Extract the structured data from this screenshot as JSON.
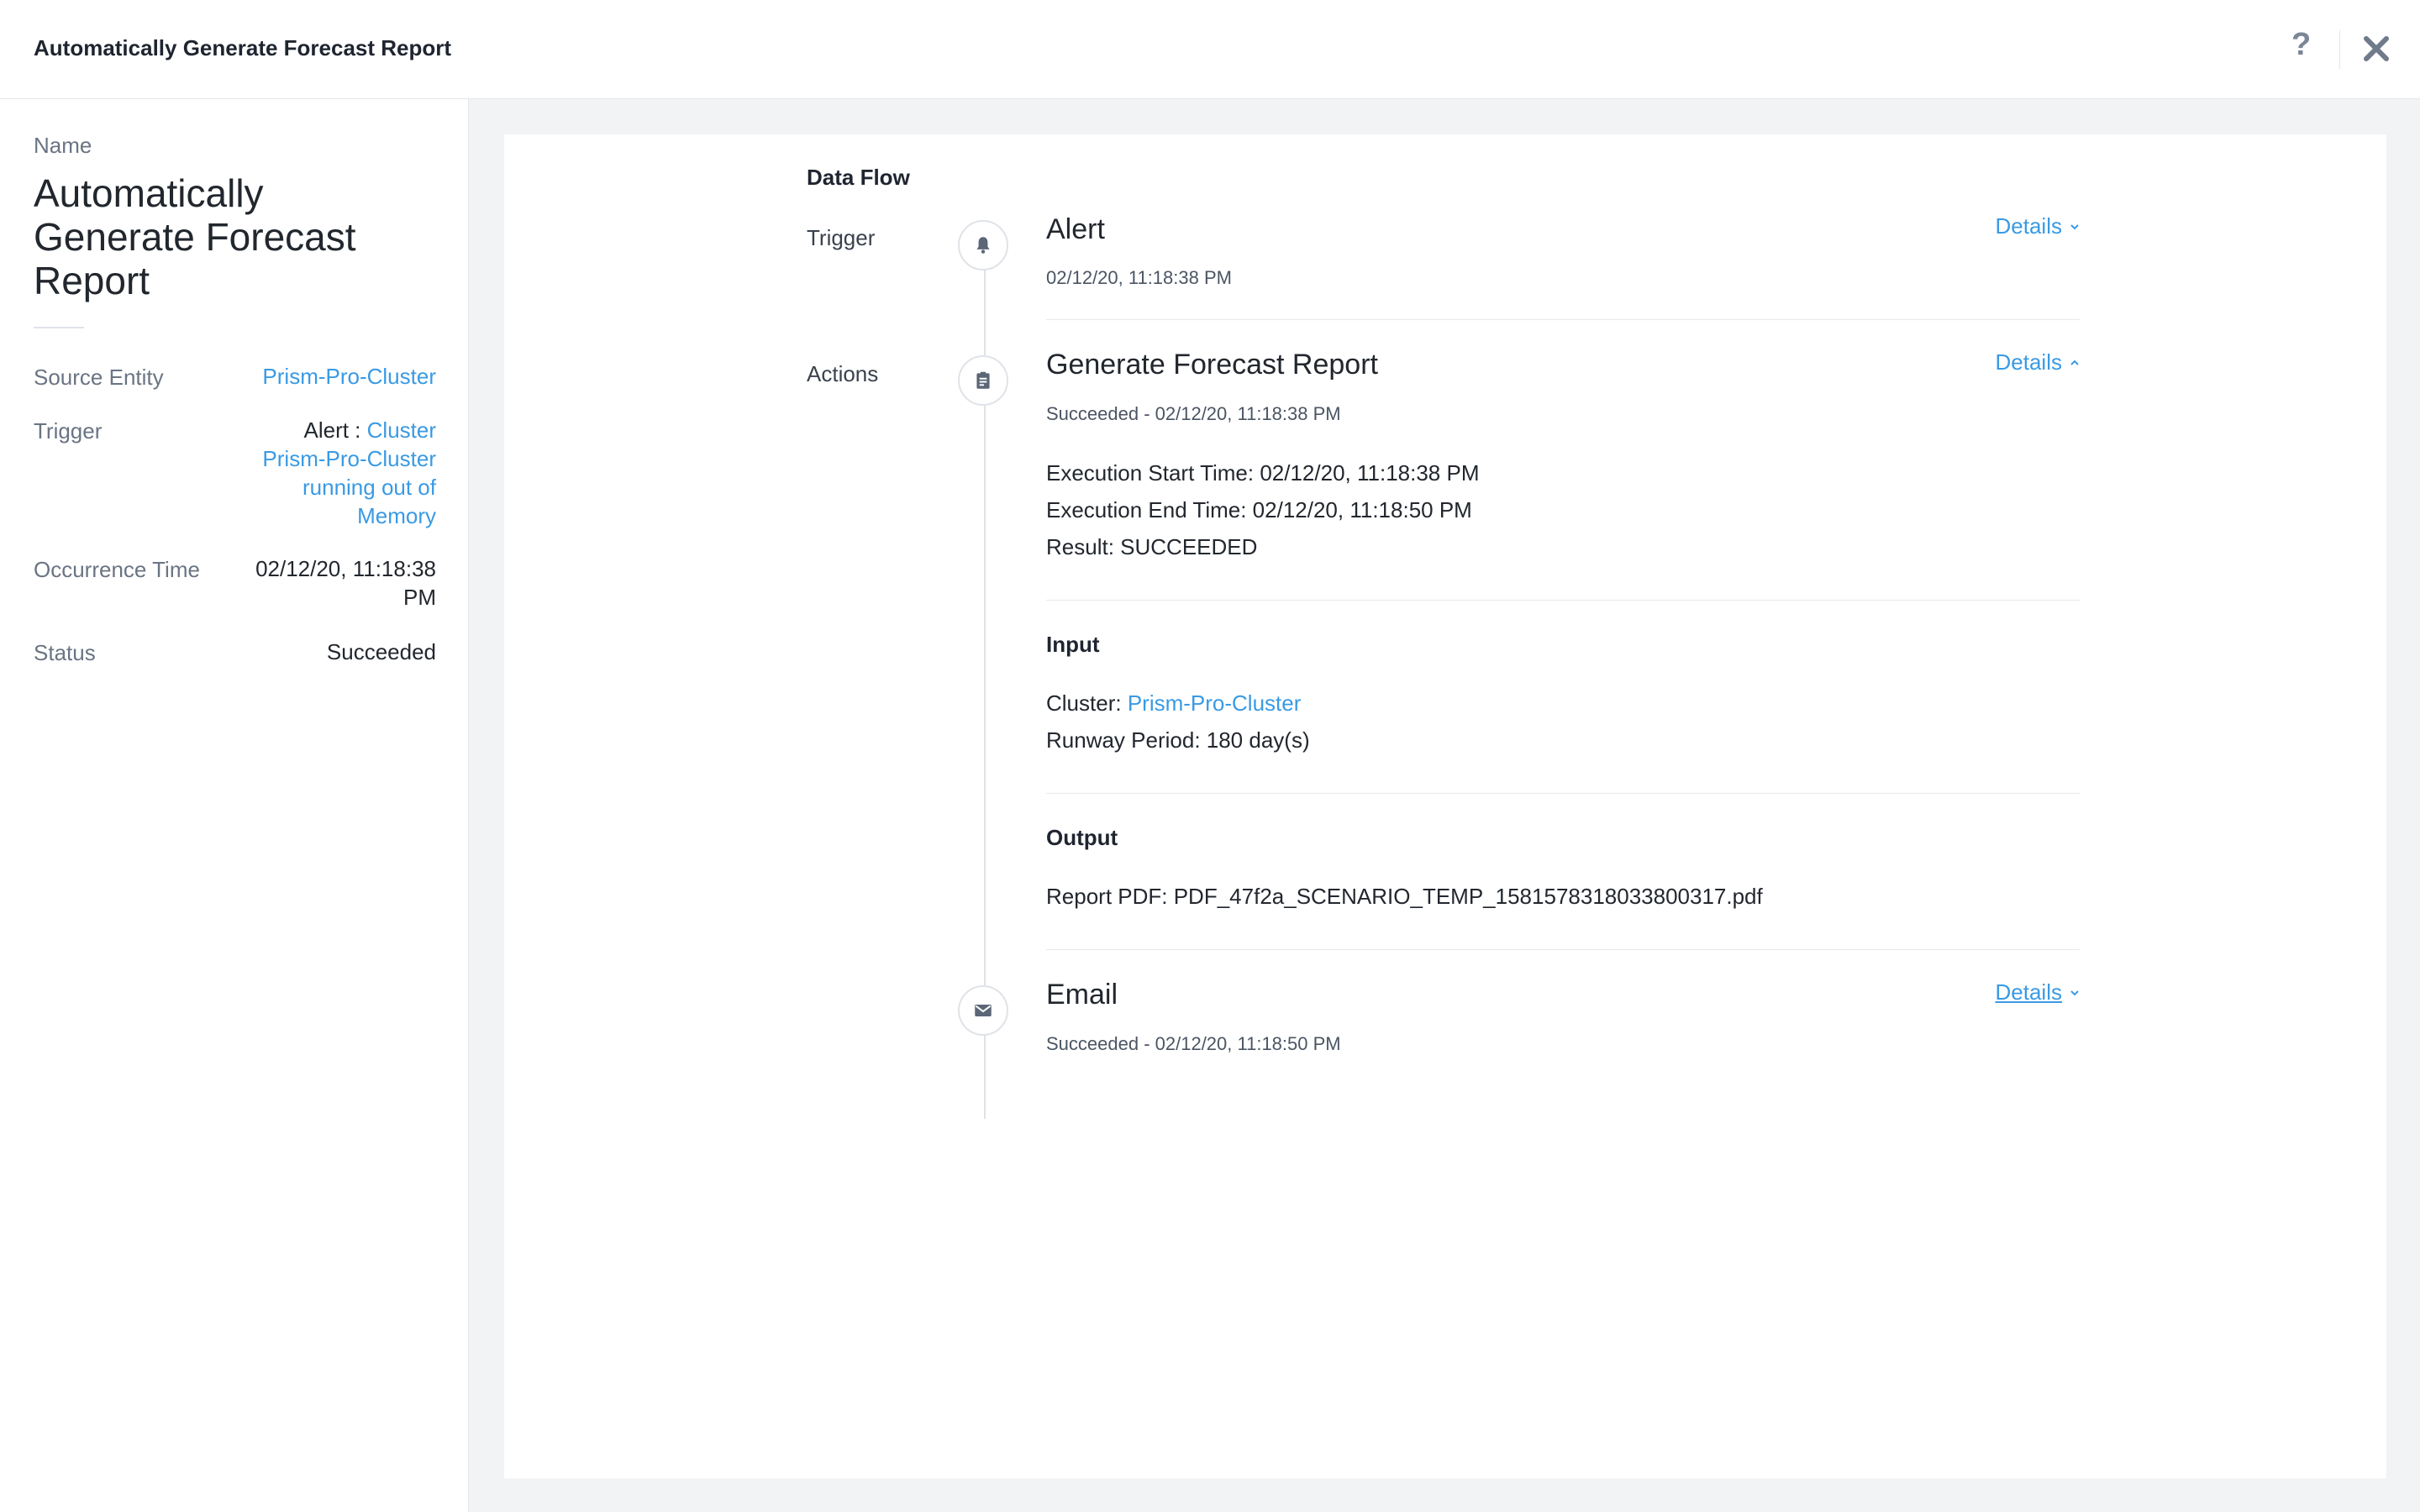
{
  "header": {
    "title": "Automatically Generate Forecast Report",
    "help_icon": "help-icon",
    "close_icon": "close-icon"
  },
  "sidebar": {
    "name_label": "Name",
    "name_value": "Automatically Generate Forecast Report",
    "source_entity": {
      "label": "Source Entity",
      "value": "Prism-Pro-Cluster"
    },
    "trigger": {
      "label": "Trigger",
      "prefix": "Alert :",
      "link_line1": "Cluster",
      "link_line2": "Prism-Pro-Cluster",
      "link_line3": "running out of",
      "link_line4": "Memory"
    },
    "occurrence_time": {
      "label": "Occurrence Time",
      "value_line1": "02/12/20, 11:18:38",
      "value_line2": "PM"
    },
    "status": {
      "label": "Status",
      "value": "Succeeded"
    }
  },
  "data_flow": {
    "title": "Data Flow",
    "trigger_label": "Trigger",
    "actions_label": "Actions",
    "alert": {
      "title": "Alert",
      "timestamp": "02/12/20, 11:18:38 PM",
      "details_label": "Details",
      "icon": "bell-icon"
    },
    "forecast": {
      "title": "Generate Forecast Report",
      "subtitle": "Succeeded - 02/12/20, 11:18:38 PM",
      "details_label": "Details",
      "icon": "clipboard-icon",
      "exec_start": "Execution Start Time: 02/12/20, 11:18:38 PM",
      "exec_end": "Execution End Time: 02/12/20, 11:18:50 PM",
      "result": "Result: SUCCEEDED",
      "input_heading": "Input",
      "cluster_label": "Cluster:",
      "cluster_value": "Prism-Pro-Cluster",
      "runway": "Runway Period: 180 day(s)",
      "output_heading": "Output",
      "report_pdf": "Report PDF: PDF_47f2a_SCENARIO_TEMP_1581578318033800317.pdf"
    },
    "email": {
      "title": "Email",
      "subtitle": "Succeeded - 02/12/20, 11:18:50 PM",
      "details_label": "Details",
      "icon": "envelope-icon"
    }
  },
  "colors": {
    "accent": "#3a9ae3",
    "background": "#f2f3f4",
    "text": "#22272e",
    "muted": "#6a7483"
  }
}
